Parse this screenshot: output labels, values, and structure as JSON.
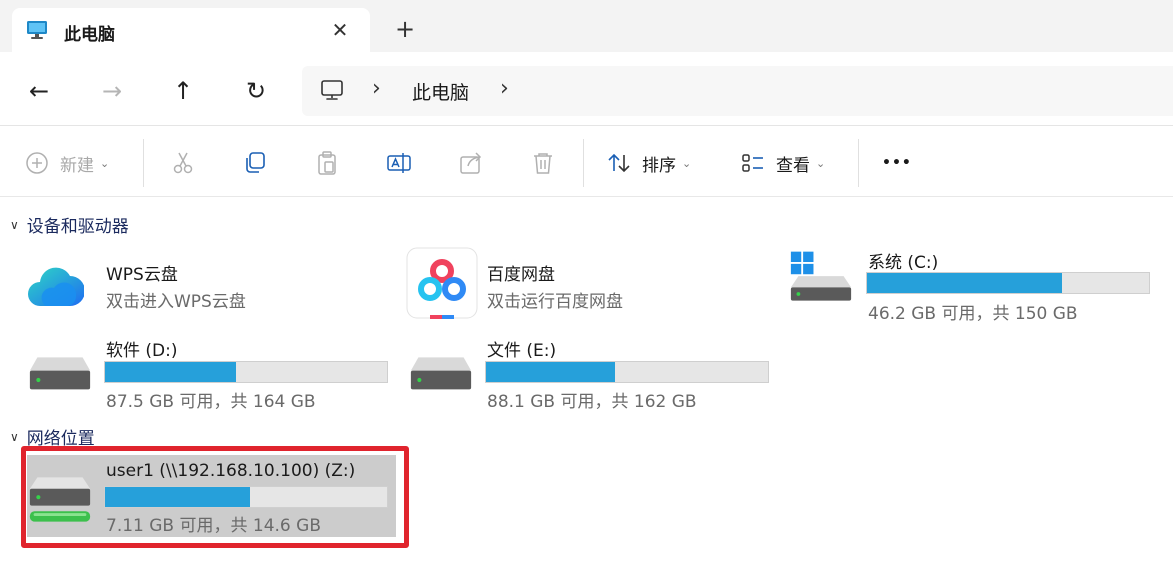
{
  "tab": {
    "title": "此电脑",
    "close": "✕",
    "new_tab": "+"
  },
  "nav": {
    "back": "←",
    "forward": "→",
    "up": "↑",
    "refresh": "↻"
  },
  "address": {
    "sep1": "›",
    "crumb": "此电脑",
    "sep2": "›"
  },
  "toolbar": {
    "new_label": "新建",
    "sort_label": "排序",
    "view_label": "查看",
    "more": "•••"
  },
  "groups": {
    "devices": {
      "title": "设备和驱动器",
      "chevron": "∨"
    },
    "network": {
      "title": "网络位置",
      "chevron": "∨"
    }
  },
  "items": {
    "wps": {
      "name": "WPS云盘",
      "sub": "双击进入WPS云盘"
    },
    "baidu": {
      "name": "百度网盘",
      "sub": "双击运行百度网盘"
    },
    "c": {
      "name": "系统 (C:)",
      "sub": "46.2 GB 可用，共 150 GB",
      "used_fraction": 0.692
    },
    "d": {
      "name": "软件 (D:)",
      "sub": "87.5 GB 可用，共 164 GB",
      "used_fraction": 0.466
    },
    "e": {
      "name": "文件 (E:)",
      "sub": "88.1 GB 可用，共 162 GB",
      "used_fraction": 0.456
    },
    "z": {
      "name": "user1 (\\\\192.168.10.100) (Z:)",
      "sub": "7.11 GB 可用，共 14.6 GB",
      "used_fraction": 0.513
    }
  },
  "colors": {
    "accent": "#26a0da",
    "highlight_frame": "#e0242d"
  }
}
